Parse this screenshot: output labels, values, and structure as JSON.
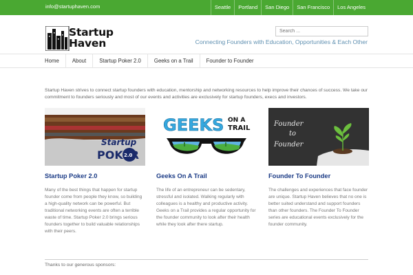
{
  "topbar": {
    "email": "info@startuphaven.com",
    "cities": [
      "Seattle",
      "Portland",
      "San Diego",
      "San Francisco",
      "Los Angeles"
    ]
  },
  "header": {
    "logo_line1": "Startup",
    "logo_line2": "Haven",
    "search_placeholder": "Search ...",
    "tagline": "Connecting Founders with Education, Opportunities & Each Other"
  },
  "nav": {
    "items": [
      "Home",
      "About",
      "Startup Poker 2.0",
      "Geeks on a Trail",
      "Founder to Founder"
    ]
  },
  "intro": "Startup Haven strives to connect startup founders with education, mentorship and networking resources to help improve their chances of success. We take our commitment to founders seriously and most of our events and activities are exclusively for startup founders, execs and investors.",
  "cards": [
    {
      "title": "Startup Poker 2.0",
      "image_text": [
        "Startup",
        "POKER",
        "2.0"
      ],
      "body": "Many of the best things that happen for startup founder come from people they know, so building a high-quality network can be powerful. But traditional networking events are often a terrible waste of time. Startup Poker 2.0 brings serious founders together to build valuable relationships with their peers."
    },
    {
      "title": "Geeks On A Trail",
      "image_text": [
        "GEEKS",
        "ON A",
        "TRAIL"
      ],
      "body": "The life of an entrepreneur can be sedentary, stressful and isolated. Walking regularly with colleagues is a healthy and productive activity.  Geeks on a Trail provides a regular opportunity for the founder community to look after their health while they look after there startup."
    },
    {
      "title": "Founder To Founder",
      "image_text": [
        "Founder",
        "to",
        "Founder"
      ],
      "body": "The challenges and experiences that face founder are unique.  Startup Haven believes that no one is better suited understand and support founders than other founders.  The Founder To Founder series are educational events exclusively for the founder community."
    }
  ],
  "footer": {
    "thanks": "Thanks to our generous sponsors:"
  },
  "colors": {
    "brand_green": "#4aa832",
    "title_blue": "#1a3a85",
    "tagline_blue": "#5e8fb0"
  }
}
